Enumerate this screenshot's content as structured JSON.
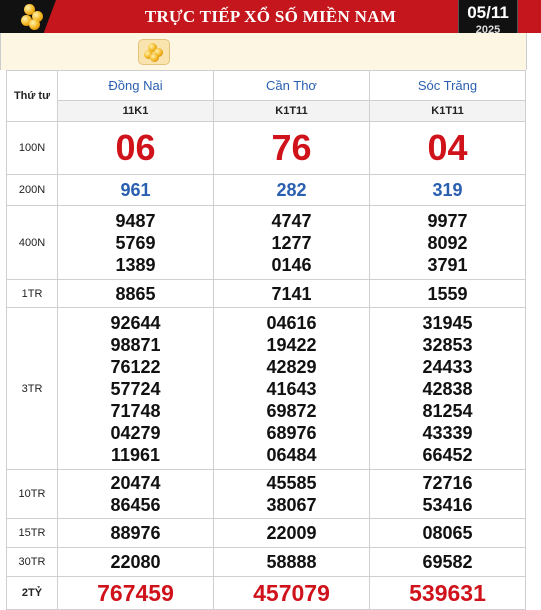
{
  "header": {
    "title": "TRỰC TIẾP XỔ SỐ MIỀN NAM",
    "date_day": "05/11",
    "date_year": "2025"
  },
  "table": {
    "corner_label": "Thứ tư",
    "provinces": [
      "Đồng Nai",
      "Cần Thơ",
      "Sóc Trăng"
    ],
    "codes": [
      "11K1",
      "K1T11",
      "K1T11"
    ],
    "prizes": [
      {
        "label": "100N",
        "cols": [
          [
            "06"
          ],
          [
            "76"
          ],
          [
            "04"
          ]
        ]
      },
      {
        "label": "200N",
        "cols": [
          [
            "961"
          ],
          [
            "282"
          ],
          [
            "319"
          ]
        ]
      },
      {
        "label": "400N",
        "cols": [
          [
            "9487",
            "5769",
            "1389"
          ],
          [
            "4747",
            "1277",
            "0146"
          ],
          [
            "9977",
            "8092",
            "3791"
          ]
        ]
      },
      {
        "label": "1TR",
        "cols": [
          [
            "8865"
          ],
          [
            "7141"
          ],
          [
            "1559"
          ]
        ]
      },
      {
        "label": "3TR",
        "cols": [
          [
            "92644",
            "98871",
            "76122",
            "57724",
            "71748",
            "04279",
            "11961"
          ],
          [
            "04616",
            "19422",
            "42829",
            "41643",
            "69872",
            "68976",
            "06484"
          ],
          [
            "31945",
            "32853",
            "24433",
            "42838",
            "81254",
            "43339",
            "66452"
          ]
        ]
      },
      {
        "label": "10TR",
        "cols": [
          [
            "20474",
            "86456"
          ],
          [
            "45585",
            "38067"
          ],
          [
            "72716",
            "53416"
          ]
        ]
      },
      {
        "label": "15TR",
        "cols": [
          [
            "88976"
          ],
          [
            "22009"
          ],
          [
            "08065"
          ]
        ]
      },
      {
        "label": "30TR",
        "cols": [
          [
            "22080"
          ],
          [
            "58888"
          ],
          [
            "69582"
          ]
        ]
      },
      {
        "label": "2TỶ",
        "cols": [
          [
            "767459"
          ],
          [
            "457079"
          ],
          [
            "539631"
          ]
        ]
      }
    ]
  },
  "colors": {
    "header_red": "#c4161c",
    "province_blue": "#2a5fb0",
    "prize_red": "#d0121b"
  }
}
